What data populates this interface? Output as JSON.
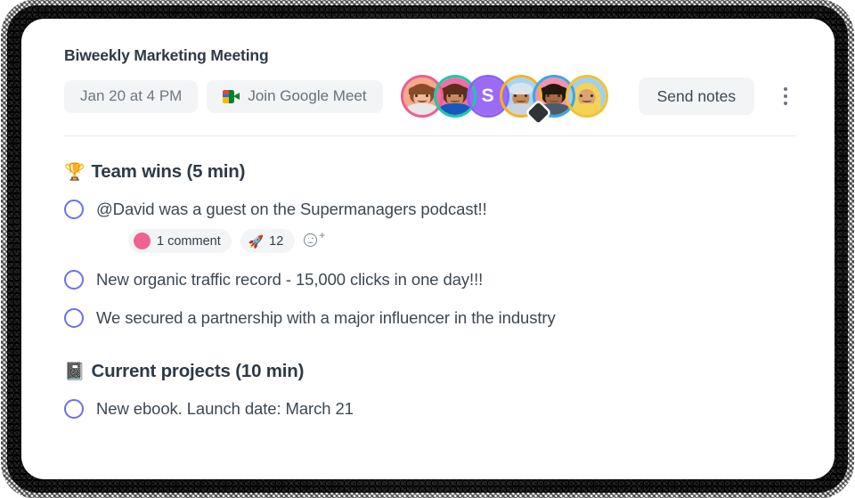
{
  "header": {
    "title": "Biweekly Marketing Meeting",
    "date_label": "Jan 20 at 4 PM",
    "meet_label": "Join Google Meet",
    "meet_icon": "google-meet-icon",
    "send_notes_label": "Send notes",
    "kebab_icon": "more-options-icon",
    "participants": [
      {
        "name": "participant-1",
        "type": "photo",
        "ring": "#ec5f8f",
        "bg": "#f6a98a",
        "skin": "#f0b894",
        "hair": "#8a4b2a",
        "shirt": "#e7e7e7",
        "initial": ""
      },
      {
        "name": "participant-2",
        "type": "photo",
        "ring": "#1fc9a6",
        "bg": "#ef6fa4",
        "skin": "#c98b5e",
        "hair": "#5a2f1b",
        "shirt": "#1558c0",
        "initial": ""
      },
      {
        "name": "participant-3",
        "type": "initial",
        "ring": "#8a63f2",
        "bg": "#9b6bf5",
        "skin": "",
        "hair": "",
        "shirt": "",
        "initial": "S"
      },
      {
        "name": "participant-4",
        "type": "turban",
        "ring": "#f5b324",
        "bg": "#a6d4f5",
        "skin": "#c78a55",
        "hair": "#d9e4ec",
        "shirt": "#c9d4dd",
        "initial": "",
        "badge": "diamond-badge"
      },
      {
        "name": "participant-5",
        "type": "photo",
        "ring": "#3ba6ea",
        "bg": "#f492ab",
        "skin": "#a96a42",
        "hair": "#251810",
        "shirt": "#4a5c6b",
        "initial": ""
      },
      {
        "name": "participant-6",
        "type": "hijab",
        "ring": "#f2c230",
        "bg": "#9fd0ef",
        "skin": "#d9a373",
        "hair": "#f3d257",
        "shirt": "#f3d257",
        "initial": ""
      }
    ]
  },
  "sections": [
    {
      "emoji": "🏆",
      "emoji_name": "trophy-emoji",
      "title": "Team wins (5 min)",
      "items": [
        {
          "text": "@David was a guest on the Supermanagers podcast!!",
          "checked": false,
          "reactions": {
            "comment_label": "1 comment",
            "comment_avatar": "commenter-avatar",
            "emoji_chip": {
              "emoji": "🚀",
              "emoji_name": "rocket-emoji",
              "count": "12"
            },
            "add_label": "add-reaction"
          }
        },
        {
          "text": "New organic traffic record - 15,000 clicks in one day!!!",
          "checked": false
        },
        {
          "text": "We secured a partnership with a major influencer in the industry",
          "checked": false
        }
      ]
    },
    {
      "emoji": "📓",
      "emoji_name": "notebook-emoji",
      "title": "Current projects (10 min)",
      "items": [
        {
          "text": "New ebook. Launch date: March 21",
          "checked": false
        }
      ]
    }
  ],
  "colors": {
    "accent_checkbox": "#6d6ef0",
    "card_bg": "#ffffff",
    "frame": "#141414",
    "chip_bg": "#f3f4f6",
    "text_primary": "#2e3a47",
    "text_body": "#3d4852",
    "divider": "#e2e7ed"
  }
}
